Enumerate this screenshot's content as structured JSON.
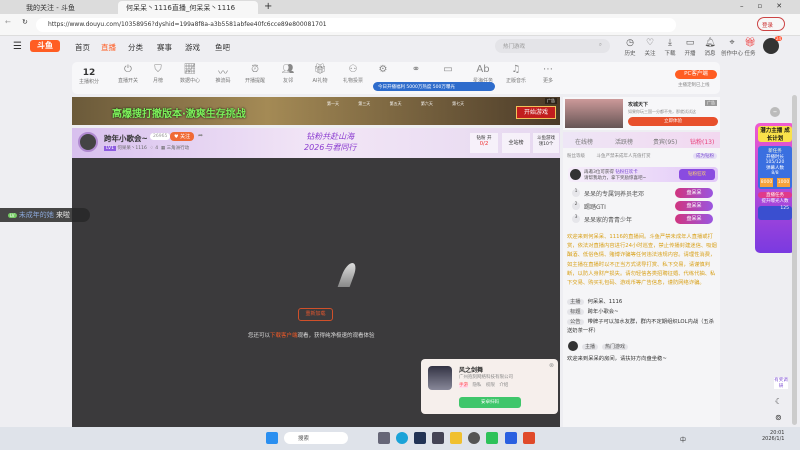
{
  "browser": {
    "tabs": [
      {
        "label": "我的关注 - 斗鱼"
      },
      {
        "label": "何呆呆丶1116直播_何呆呆丶1116"
      }
    ],
    "url": "https://www.douyu.com/10358956?dyshid=199a8f8a-a3b5581abfee40fc6cce89e800081701",
    "login": "登录"
  },
  "header": {
    "logo": "斗鱼",
    "nav": [
      "首页",
      "直播",
      "分类",
      "赛事",
      "游戏",
      "鱼吧"
    ],
    "search_placeholder": "热门游戏",
    "icons": [
      "历史",
      "关注",
      "下载",
      "开播",
      "消息",
      "创作中心",
      "任务"
    ],
    "avatar_badge": "24"
  },
  "toolbar": {
    "points": "12",
    "points_label": "主播积分",
    "items": [
      "直播开关",
      "月榜",
      "数据中心",
      "推流码",
      "开播提醒",
      "友邻",
      "AI礼物",
      "礼物投票",
      "",
      "",
      "",
      "星海任务",
      "正版音乐",
      "更多"
    ],
    "toast": "今日开播福利 5000万热度 500万曝光",
    "pc_client": "PC客户端",
    "pc_sub": "主播定制已上线"
  },
  "ad": {
    "title": "高爆搜打撤版本·激爽生存挑战",
    "days": [
      "第一天",
      "第三天",
      "第五天",
      "第六天",
      "第七天"
    ],
    "button": "开始游戏",
    "tag": "广告"
  },
  "room": {
    "title": "跨年小歌会~",
    "fans": "26965",
    "follow": "关注",
    "level": "LV1",
    "anchor": "何呆呆丶1116",
    "likes": "4",
    "category": "三角洲行动",
    "banner_line1": "钻粉共赴山海",
    "banner_line2": "2026与君同行",
    "diamond_label": "钻粉 开",
    "diamond_count": "0/2",
    "all_rank": "全站榜",
    "game_label": "斗鱼游戏",
    "game_sub": "领10个"
  },
  "video": {
    "reload": "重新加载",
    "tip_pre": "您还可以",
    "tip_link": "下载客户端",
    "tip_post": "观看，获得纯净极速的观看体验",
    "danmaku_user": "未成年的她",
    "danmaku_text": "来啦"
  },
  "popup": {
    "name": "风之剑舞",
    "company": "广州抱刻网络科技有限公司",
    "tags": [
      "手游",
      "隐私",
      "权限",
      "介绍"
    ],
    "button": "安卓扫码"
  },
  "side_ad": {
    "title": "攻城天下",
    "desc": "如果你玩三国一分都不充，那就试试这",
    "button": "立即体验",
    "tag": "广告"
  },
  "rank_tabs": [
    "在线榜",
    "活跃榜",
    "贵宾(95)",
    "钻粉(13)"
  ],
  "fan_level": {
    "label": "粉丝等级",
    "rule": "斗鱼严禁未成年人充值打赏",
    "become": "成为钻粉"
  },
  "promo": {
    "text1": "再邀3位可获得",
    "text2": "钻粉狂欢卡",
    "text3": "请帮我助力，拿下奖励惊喜吧~",
    "badge": "钻粉狂欢"
  },
  "rank_list": [
    {
      "n": "1",
      "name": "呆呆的专属饲养员老邓",
      "badge": "盘呆呆"
    },
    {
      "n": "2",
      "name": "踢踏GTI",
      "badge": "盘呆呆"
    },
    {
      "n": "3",
      "name": "呆呆家的青青少年",
      "badge": "盘呆呆"
    }
  ],
  "chat": {
    "notice": "欢迎来到何呆呆、1116的直播间。斗鱼严禁未成年人直播或打赏，依法对直播内容进行24小时巡查，禁止传播封建迷信、吸烟酗酒、低俗色情、赌博诈骗等任何违法违规内容。请理性消费，如主播在直播时以不正当方式诱导打赏、私下交易，请谨慎判断，以防人身财产损失。请勿轻信各类招聘征婚、代练代抽、私下交易、购买礼包码、游戏币等广告信息，谨防网络诈骗。",
    "rows": [
      {
        "k": "主播",
        "v": "何呆呆、1116"
      },
      {
        "k": "标题",
        "v": "跨年小歌会~"
      },
      {
        "k": "公告",
        "v": "带牌子可以加水友群，群内不定期组织LOL内战（五杀送奶茶一杯）"
      }
    ],
    "user_tags": [
      "主播",
      "热门游戏"
    ],
    "welcome": "欢迎来到呆呆的房间，请扶好方向盘坐稳~"
  },
  "widget": {
    "title": "潜力主播 成长计划",
    "sub": "新任务",
    "duration": "开播时长",
    "duration_val": "105/120",
    "danmu": "弹幕人数",
    "danmu_val": "8/8",
    "r1": "8000",
    "r2": "1000",
    "mission": "直播任务",
    "mission_sub": "提升曝光人数",
    "card_count": "125",
    "survey": "有奖调研"
  },
  "taskbar": {
    "search": "搜索",
    "time": "20:01",
    "date": "2026/1/1",
    "ime": "中"
  }
}
